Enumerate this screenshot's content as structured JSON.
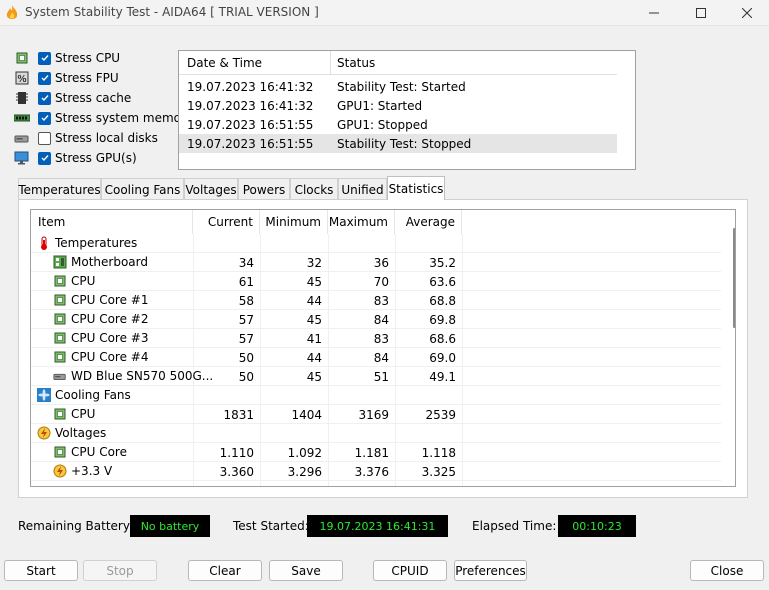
{
  "window": {
    "title": "System Stability Test - AIDA64  [ TRIAL VERSION ]"
  },
  "stress_options": [
    {
      "label": "Stress CPU",
      "checked": true,
      "icon": "cpu-chip-icon"
    },
    {
      "label": "Stress FPU",
      "checked": true,
      "icon": "fpu-percent-icon"
    },
    {
      "label": "Stress cache",
      "checked": true,
      "icon": "cache-chip-icon"
    },
    {
      "label": "Stress system memory",
      "checked": true,
      "icon": "memory-module-icon"
    },
    {
      "label": "Stress local disks",
      "checked": false,
      "icon": "disk-drive-icon"
    },
    {
      "label": "Stress GPU(s)",
      "checked": true,
      "icon": "monitor-icon"
    }
  ],
  "status_log": {
    "headers": {
      "date_time": "Date & Time",
      "status": "Status"
    },
    "rows": [
      {
        "date": "19.07.2023 16:41:32",
        "status": "Stability Test: Started"
      },
      {
        "date": "19.07.2023 16:41:32",
        "status": "GPU1: Started"
      },
      {
        "date": "19.07.2023 16:51:55",
        "status": "GPU1: Stopped"
      },
      {
        "date": "19.07.2023 16:51:55",
        "status": "Stability Test: Stopped"
      }
    ]
  },
  "tabs": [
    {
      "label": "Temperatures"
    },
    {
      "label": "Cooling Fans"
    },
    {
      "label": "Voltages"
    },
    {
      "label": "Powers"
    },
    {
      "label": "Clocks"
    },
    {
      "label": "Unified"
    },
    {
      "label": "Statistics",
      "active": true
    }
  ],
  "stats": {
    "headers": {
      "item": "Item",
      "current": "Current",
      "minimum": "Minimum",
      "maximum": "Maximum",
      "average": "Average"
    },
    "rows": [
      {
        "kind": "group",
        "item": "Temperatures",
        "icon": "thermometer-icon"
      },
      {
        "kind": "data",
        "item": "Motherboard",
        "icon": "motherboard-icon",
        "current": "34",
        "minimum": "32",
        "maximum": "36",
        "average": "35.2"
      },
      {
        "kind": "data",
        "item": "CPU",
        "icon": "cpu-chip-icon",
        "current": "61",
        "minimum": "45",
        "maximum": "70",
        "average": "63.6"
      },
      {
        "kind": "data",
        "item": "CPU Core #1",
        "icon": "cpu-chip-icon",
        "current": "58",
        "minimum": "44",
        "maximum": "83",
        "average": "68.8"
      },
      {
        "kind": "data",
        "item": "CPU Core #2",
        "icon": "cpu-chip-icon",
        "current": "57",
        "minimum": "45",
        "maximum": "84",
        "average": "69.8"
      },
      {
        "kind": "data",
        "item": "CPU Core #3",
        "icon": "cpu-chip-icon",
        "current": "57",
        "minimum": "41",
        "maximum": "83",
        "average": "68.6"
      },
      {
        "kind": "data",
        "item": "CPU Core #4",
        "icon": "cpu-chip-icon",
        "current": "50",
        "minimum": "44",
        "maximum": "84",
        "average": "69.0"
      },
      {
        "kind": "data",
        "item": "WD Blue SN570 500G...",
        "icon": "disk-drive-icon",
        "current": "50",
        "minimum": "45",
        "maximum": "51",
        "average": "49.1"
      },
      {
        "kind": "group",
        "item": "Cooling Fans",
        "icon": "fan-icon"
      },
      {
        "kind": "data",
        "item": "CPU",
        "icon": "cpu-chip-icon",
        "current": "1831",
        "minimum": "1404",
        "maximum": "3169",
        "average": "2539"
      },
      {
        "kind": "group",
        "item": "Voltages",
        "icon": "voltage-icon"
      },
      {
        "kind": "data",
        "item": "CPU Core",
        "icon": "cpu-chip-icon",
        "current": "1.110",
        "minimum": "1.092",
        "maximum": "1.181",
        "average": "1.118"
      },
      {
        "kind": "data",
        "item": "+3.3 V",
        "icon": "voltage-icon",
        "current": "3.360",
        "minimum": "3.296",
        "maximum": "3.376",
        "average": "3.325"
      }
    ]
  },
  "footer": {
    "battery_label": "Remaining Battery:",
    "battery_value": "No battery",
    "started_label": "Test Started:",
    "started_value": "19.07.2023 16:41:31",
    "elapsed_label": "Elapsed Time:",
    "elapsed_value": "00:10:23"
  },
  "buttons": {
    "start": "Start",
    "stop": "Stop",
    "clear": "Clear",
    "save": "Save",
    "cpuid": "CPUID",
    "preferences": "Preferences",
    "close": "Close"
  },
  "colors": {
    "accent": "#005fb8",
    "lcd_text": "#2ee82e",
    "lcd_background": "#000000"
  }
}
